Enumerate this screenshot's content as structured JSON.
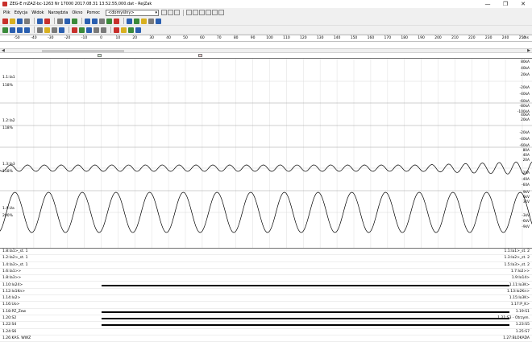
{
  "window": {
    "title": "ZEG-E  mZAZ-bc-1263 Nr 17000 2017.08.31 13.52.55,000.dat - RejZak",
    "minimize": "—",
    "maximize": "❐",
    "close": "✕"
  },
  "menu": {
    "items": [
      "Plik",
      "Edycja",
      "Widok",
      "Narzędzia",
      "Okno",
      "Pomoc"
    ],
    "view_combo": "<domyślny>"
  },
  "toolbar_colors": {
    "red": "#c8302c",
    "blue": "#2a5fb0",
    "green": "#3a8a3a",
    "yellow": "#d8b020",
    "gray": "#7a7a7a"
  },
  "ruler": {
    "ticks": [
      "-50",
      "-40",
      "-30",
      "-20",
      "-10",
      "0",
      "10",
      "20",
      "30",
      "40",
      "50",
      "60",
      "70",
      "80",
      "90",
      "100",
      "110",
      "120",
      "130",
      "140",
      "150",
      "160",
      "170",
      "180",
      "190",
      "200",
      "210",
      "220",
      "230",
      "240",
      "250"
    ],
    "unit": "ms"
  },
  "analog_channels": [
    {
      "name": "1.1:Ia1",
      "percent": "118%",
      "scale": [
        "80kA",
        "40kA",
        "20kA"
      ]
    },
    {
      "name": "1.2:Ia2",
      "percent": "118%",
      "scale": [
        "-20kA",
        "-40kA",
        "-60kA",
        "-80kA",
        "-100kA",
        "40kA",
        "20kA"
      ]
    },
    {
      "name": "1.3:Ia3",
      "percent": "118%",
      "scale": [
        "-20kA",
        "-40kA",
        "-60kA",
        "80A",
        "40A",
        "20A",
        "-20A",
        "-40A",
        "-60A"
      ]
    },
    {
      "name": "1.4:Ua",
      "percent": "200%",
      "scale": [
        "9kV",
        "6kV",
        "3kV",
        "-3kV",
        "-6kV",
        "-9kV"
      ]
    }
  ],
  "digital_channels": [
    {
      "left": "1.8:Ia1>_st. 1",
      "right": "1.1:Ia1>_st. 2",
      "active": false
    },
    {
      "left": "1.2:Ia2>_st. 1",
      "right": "1.3:Ia2>_st. 2",
      "active": false
    },
    {
      "left": "1.4:Ia3>_st. 1",
      "right": "1.5:Ia3>_st. 2",
      "active": false
    },
    {
      "left": "1.6:Ia1>>",
      "right": "1.7:Io2>>",
      "active": false
    },
    {
      "left": "1.8:Ia3>>",
      "right": "1.9:Io14>",
      "active": false
    },
    {
      "left": "1.10:Io24>",
      "right": "1.11:Io3K>",
      "active": true
    },
    {
      "left": "1.12:Io1Kn>",
      "right": "1.13:Io2Kn>",
      "active": false
    },
    {
      "left": "1.14:Io2>",
      "right": "1.15:Io3K>",
      "active": false
    },
    {
      "left": "1.16:Uo>",
      "right": "1.17:P_K>",
      "active": false
    },
    {
      "left": "1.18:PZ_Zew",
      "right": "1.19:S1",
      "active": true
    },
    {
      "left": "1.20:S2",
      "right": "1.21:S3 - Otrzym.",
      "active": true
    },
    {
      "left": "1.22:S4",
      "right": "1.23:S5",
      "active": true
    },
    {
      "left": "1.24:S6",
      "right": "1.25:S7",
      "active": false
    },
    {
      "left": "1.26:KAS. WWZ",
      "right": "1.27:BLOKADA",
      "active": false
    }
  ]
}
